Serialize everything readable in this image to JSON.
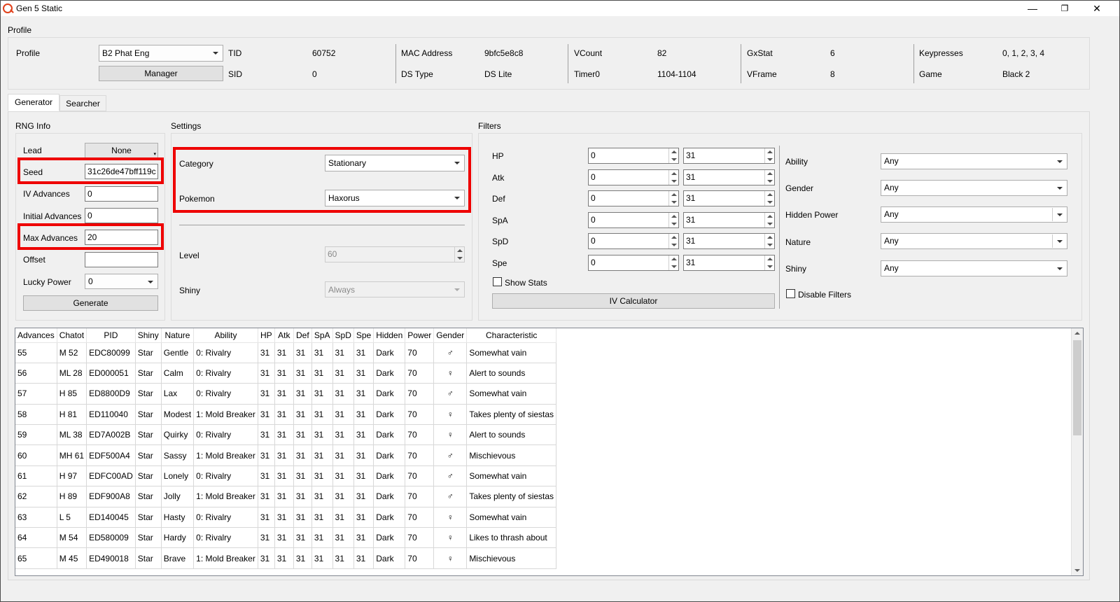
{
  "window": {
    "title": "Gen 5 Static",
    "minimize": "—",
    "restore": "❐",
    "close": "✕"
  },
  "profile": {
    "section": "Profile",
    "profile_label": "Profile",
    "profile_value": "B2 Phat Eng",
    "manager_button": "Manager",
    "fields": [
      {
        "label": "TID",
        "value": "60752"
      },
      {
        "label": "SID",
        "value": "0"
      },
      {
        "label": "MAC Address",
        "value": "9bfc5e8c8"
      },
      {
        "label": "DS Type",
        "value": "DS Lite"
      },
      {
        "label": "VCount",
        "value": "82"
      },
      {
        "label": "Timer0",
        "value": "1104-1104"
      },
      {
        "label": "GxStat",
        "value": "6"
      },
      {
        "label": "VFrame",
        "value": "8"
      },
      {
        "label": "Keypresses",
        "value": "0, 1, 2, 3, 4"
      },
      {
        "label": "Game",
        "value": "Black 2"
      }
    ]
  },
  "tabs": [
    {
      "label": "Generator"
    },
    {
      "label": "Searcher"
    }
  ],
  "rng_info": {
    "title": "RNG Info",
    "lead_label": "Lead",
    "lead_value": "None",
    "seed_label": "Seed",
    "seed_value": "31c26de47bff119c",
    "iv_adv_label": "IV Advances",
    "iv_adv_value": "0",
    "initial_adv_label": "Initial Advances",
    "initial_adv_value": "0",
    "max_adv_label": "Max Advances",
    "max_adv_value": "20",
    "offset_label": "Offset",
    "offset_value": "",
    "lucky_label": "Lucky Power",
    "lucky_value": "0",
    "generate": "Generate"
  },
  "settings": {
    "title": "Settings",
    "category_label": "Category",
    "category_value": "Stationary",
    "pokemon_label": "Pokemon",
    "pokemon_value": "Haxorus",
    "level_label": "Level",
    "level_value": "60",
    "shiny_label": "Shiny",
    "shiny_value": "Always"
  },
  "filters": {
    "title": "Filters",
    "stats": [
      {
        "label": "HP",
        "min": "0",
        "max": "31"
      },
      {
        "label": "Atk",
        "min": "0",
        "max": "31"
      },
      {
        "label": "Def",
        "min": "0",
        "max": "31"
      },
      {
        "label": "SpA",
        "min": "0",
        "max": "31"
      },
      {
        "label": "SpD",
        "min": "0",
        "max": "31"
      },
      {
        "label": "Spe",
        "min": "0",
        "max": "31"
      }
    ],
    "show_stats": "Show Stats",
    "iv_calc": "IV Calculator",
    "ability_label": "Ability",
    "ability_value": "Any",
    "gender_label": "Gender",
    "gender_value": "Any",
    "hp_label": "Hidden Power",
    "hp_value": "Any",
    "nature_label": "Nature",
    "nature_value": "Any",
    "shiny_label": "Shiny",
    "shiny_value": "Any",
    "disable_filters": "Disable Filters"
  },
  "table": {
    "headers": [
      "Advances",
      "Chatot",
      "PID",
      "Shiny",
      "Nature",
      "Ability",
      "HP",
      "Atk",
      "Def",
      "SpA",
      "SpD",
      "Spe",
      "Hidden",
      "Power",
      "Gender",
      "Characteristic"
    ],
    "rows": [
      [
        "55",
        "M 52",
        "EDC80099",
        "Star",
        "Gentle",
        "0: Rivalry",
        "31",
        "31",
        "31",
        "31",
        "31",
        "31",
        "Dark",
        "70",
        "♂",
        "Somewhat vain"
      ],
      [
        "56",
        "ML 28",
        "ED000051",
        "Star",
        "Calm",
        "0: Rivalry",
        "31",
        "31",
        "31",
        "31",
        "31",
        "31",
        "Dark",
        "70",
        "♀",
        "Alert to sounds"
      ],
      [
        "57",
        "H 85",
        "ED8800D9",
        "Star",
        "Lax",
        "0: Rivalry",
        "31",
        "31",
        "31",
        "31",
        "31",
        "31",
        "Dark",
        "70",
        "♂",
        "Somewhat vain"
      ],
      [
        "58",
        "H 81",
        "ED110040",
        "Star",
        "Modest",
        "1: Mold Breaker",
        "31",
        "31",
        "31",
        "31",
        "31",
        "31",
        "Dark",
        "70",
        "♀",
        "Takes plenty of siestas"
      ],
      [
        "59",
        "ML 38",
        "ED7A002B",
        "Star",
        "Quirky",
        "0: Rivalry",
        "31",
        "31",
        "31",
        "31",
        "31",
        "31",
        "Dark",
        "70",
        "♀",
        "Alert to sounds"
      ],
      [
        "60",
        "MH 61",
        "EDF500A4",
        "Star",
        "Sassy",
        "1: Mold Breaker",
        "31",
        "31",
        "31",
        "31",
        "31",
        "31",
        "Dark",
        "70",
        "♂",
        "Mischievous"
      ],
      [
        "61",
        "H 97",
        "EDFC00AD",
        "Star",
        "Lonely",
        "0: Rivalry",
        "31",
        "31",
        "31",
        "31",
        "31",
        "31",
        "Dark",
        "70",
        "♂",
        "Somewhat vain"
      ],
      [
        "62",
        "H 89",
        "EDF900A8",
        "Star",
        "Jolly",
        "1: Mold Breaker",
        "31",
        "31",
        "31",
        "31",
        "31",
        "31",
        "Dark",
        "70",
        "♂",
        "Takes plenty of siestas"
      ],
      [
        "63",
        "L 5",
        "ED140045",
        "Star",
        "Hasty",
        "0: Rivalry",
        "31",
        "31",
        "31",
        "31",
        "31",
        "31",
        "Dark",
        "70",
        "♀",
        "Somewhat vain"
      ],
      [
        "64",
        "M 54",
        "ED580009",
        "Star",
        "Hardy",
        "0: Rivalry",
        "31",
        "31",
        "31",
        "31",
        "31",
        "31",
        "Dark",
        "70",
        "♀",
        "Likes to thrash about"
      ],
      [
        "65",
        "M 45",
        "ED490018",
        "Star",
        "Brave",
        "1: Mold Breaker",
        "31",
        "31",
        "31",
        "31",
        "31",
        "31",
        "Dark",
        "70",
        "♀",
        "Mischievous"
      ]
    ]
  }
}
